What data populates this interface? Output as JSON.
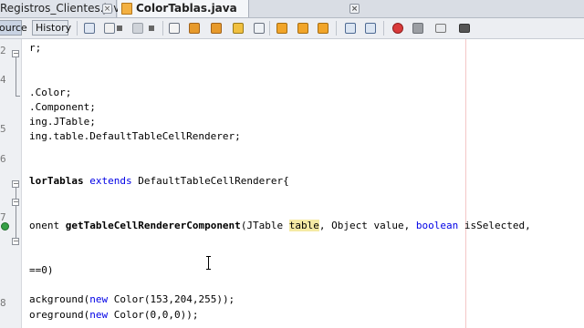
{
  "tabs": [
    {
      "label": "Registros_Clientes.java",
      "close": "×"
    },
    {
      "label": "ColorTablas.java",
      "close": "×"
    }
  ],
  "toolbar": {
    "source_label": "ource",
    "history_label": "History"
  },
  "editor": {
    "gutter_digits": [
      "2",
      "4",
      "5",
      "6",
      "7",
      "8"
    ],
    "lines": {
      "l1": "r;",
      "l2": ".Color;",
      "l3": ".Component;",
      "l4": "ing.JTable;",
      "l5": "ing.table.DefaultTableCellRenderer;",
      "l6_a": "lorTablas ",
      "l6_kw": "extends",
      "l6_b": " DefaultTableCellRenderer{",
      "l7_a": "onent ",
      "l7_method": "getTableCellRendererComponent",
      "l7_b": "(JTable ",
      "l7_hl": "table",
      "l7_c": ", Object value, ",
      "l7_kw": "boolean",
      "l7_d": " isSelected,",
      "l8": "==0)",
      "l9_a": "ackground(",
      "l9_kw": "new",
      "l9_b": " Color(153,204,255));",
      "l10_a": "oreground(",
      "l10_kw": "new",
      "l10_b": " Color(0,0,0));"
    }
  },
  "colors": {
    "keyword": "#0000e6",
    "highlight": "#f5eaa4",
    "margin_line": "#f4c7c7",
    "breakpoint_marker": "#36a046"
  }
}
